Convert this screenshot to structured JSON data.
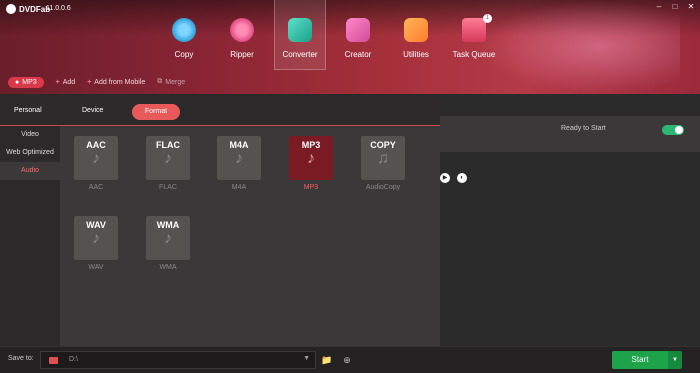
{
  "app": {
    "logo": "DVDFab",
    "version": "11.0.0.6"
  },
  "nav": {
    "items": [
      {
        "label": "Copy",
        "icon": "copy-icon"
      },
      {
        "label": "Ripper",
        "icon": "ripper-icon"
      },
      {
        "label": "Converter",
        "icon": "converter-icon",
        "active": true
      },
      {
        "label": "Creator",
        "icon": "creator-icon"
      },
      {
        "label": "Utilities",
        "icon": "utilities-icon"
      },
      {
        "label": "Task Queue",
        "icon": "task-queue-icon",
        "badge": "1"
      }
    ]
  },
  "toolbar": {
    "profile": "MP3",
    "add": "Add",
    "add_mobile": "Add from Mobile",
    "merge": "Merge"
  },
  "panel": {
    "tabs": {
      "personal": "Personal",
      "device": "Device",
      "format": "Format"
    },
    "side": [
      "Video",
      "Web Optimized",
      "Audio"
    ],
    "formats": [
      {
        "name": "AAC",
        "caption": "AAC"
      },
      {
        "name": "FLAC",
        "caption": "FLAC"
      },
      {
        "name": "M4A",
        "caption": "M4A"
      },
      {
        "name": "MP3",
        "caption": "MP3",
        "selected": true
      },
      {
        "name": "COPY",
        "caption": "AudioCopy"
      },
      {
        "name": "WAV",
        "caption": "WAV"
      },
      {
        "name": "WMA",
        "caption": "WMA"
      }
    ]
  },
  "task": {
    "status": "Ready to Start",
    "toggle_on": true
  },
  "bottom": {
    "save_to": "Save to:",
    "path": "D:\\",
    "start": "Start"
  },
  "colors": {
    "accent": "#d93a4a",
    "start_green": "#1fa34a"
  }
}
